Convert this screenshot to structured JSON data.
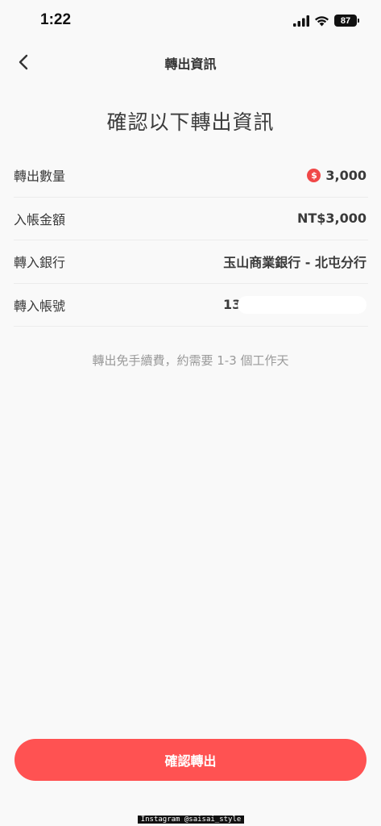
{
  "status_bar": {
    "time": "1:22",
    "battery": "87"
  },
  "nav": {
    "title": "轉出資訊"
  },
  "heading": "確認以下轉出資訊",
  "details": [
    {
      "label": "轉出數量",
      "value": "3,000"
    },
    {
      "label": "入帳金額",
      "value": "NT$3,000"
    },
    {
      "label": "轉入銀行",
      "value": "玉山商業銀行 - 北屯分行"
    },
    {
      "label": "轉入帳號",
      "value": "13"
    }
  ],
  "coin_symbol": "$",
  "fee_note": "轉出免手續費，約需要 1-3 個工作天",
  "confirm_label": "確認轉出",
  "watermark": "Instagram @saisai_style",
  "colors": {
    "accent": "#ff5252",
    "coin": "#f04848",
    "background": "#f9f9f9"
  }
}
